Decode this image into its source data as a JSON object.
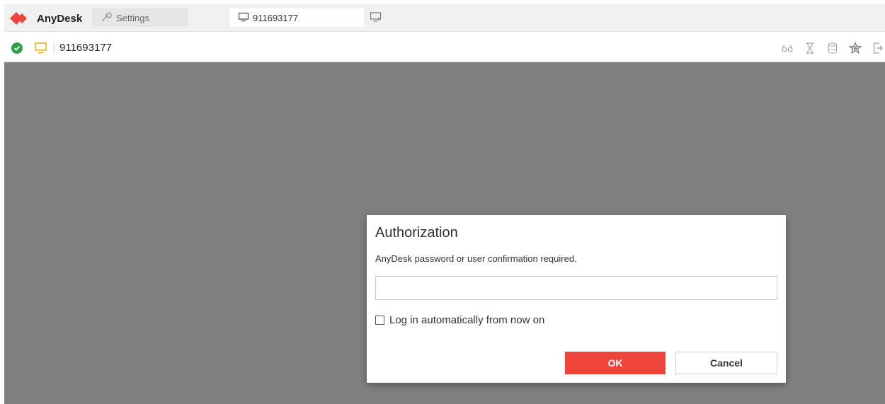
{
  "app": {
    "name": "AnyDesk",
    "brand_color": "#ef443b"
  },
  "tabs": {
    "settings_label": "Settings",
    "connection_label": "911693177"
  },
  "toolbar": {
    "address": "911693177",
    "status_color": "#2e9e48",
    "icons": [
      "glasses-icon",
      "hourglass-icon",
      "database-icon",
      "star-icon",
      "exit-icon"
    ]
  },
  "dialog": {
    "title": "Authorization",
    "message": "AnyDesk password or user confirmation required.",
    "password_value": "",
    "checkbox_label": "Log in automatically from now on",
    "checkbox_checked": false,
    "ok_label": "OK",
    "cancel_label": "Cancel",
    "ok_color": "#ef443b"
  }
}
